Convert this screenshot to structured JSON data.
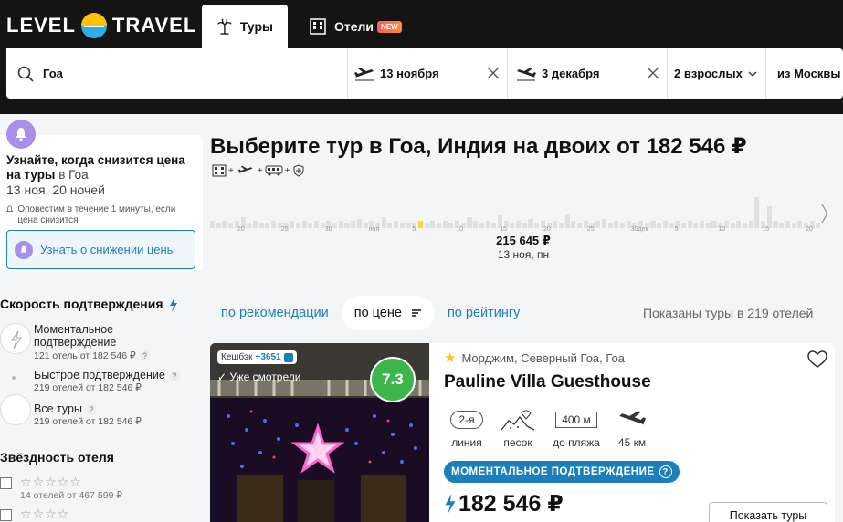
{
  "header": {
    "logo_left": "LEVEL",
    "logo_right": "TRAVEL",
    "tabs": [
      {
        "label": "Туры",
        "active": true
      },
      {
        "label": "Отели",
        "badge": "NEW",
        "active": false
      }
    ]
  },
  "search": {
    "destination": "Гоа",
    "date_from": "13 ноября",
    "date_to": "3 декабря",
    "passengers": "2 взрослых",
    "origin": "из Москвы"
  },
  "alert": {
    "title": "Узнайте, когда снизится цена на туры",
    "city": "в Гоа",
    "subtitle": "13 ноя,  20 ночей",
    "note": "Оповестим в течение 1 минуты, если цена снизится",
    "button": "Узнать о снижении цены"
  },
  "filters": {
    "confirm_title": "Скорость подтверждения",
    "confirm_options": [
      {
        "label": "Моментальное подтверждение",
        "count": "121 отель от 182 546 ₽"
      },
      {
        "label": "Быстрое подтверждение",
        "count": "219 отелей от 182 546 ₽"
      },
      {
        "label": "Все туры",
        "count": "219 отелей от 182 546 ₽"
      }
    ],
    "stars_title": "Звёздность отеля",
    "star_options": [
      {
        "stars": "☆☆☆☆☆",
        "count": "14 отелей от 467 599 ₽"
      },
      {
        "stars": "☆☆☆☆",
        "count": ""
      }
    ]
  },
  "main": {
    "title": "Выберите тур в Гоа, Индия на двоих от 182 546 ₽",
    "calendar": {
      "selected_price": "215 645 ₽",
      "selected_date": "13 ноя, пн",
      "ticks": [
        "20",
        "25",
        "30",
        "ноя",
        "5",
        "10",
        "15",
        "20",
        "25",
        "30дек",
        "5",
        "10",
        "15",
        "20"
      ],
      "bar_levels": [
        0.2,
        0.15,
        0.2,
        0.15,
        0.2,
        0.3,
        0.15,
        0.2,
        0.15,
        0.15,
        0.2,
        0.15,
        0.15,
        0.2,
        0.15,
        0.2,
        0.15,
        0.2,
        0.15,
        0.2,
        0.15,
        0.2,
        0.15,
        0.2,
        0.25,
        0.15,
        0.2,
        0.15,
        0.3,
        0.15,
        0.2,
        0.15,
        0.15,
        0.15,
        0.2,
        0.15,
        0.2,
        0.15,
        0.2,
        0.15,
        0.2,
        0.15,
        0.3,
        0.2,
        0.15,
        0.2,
        0.15,
        0.35,
        0.2,
        0.15,
        0.2,
        0.15,
        0.25,
        0.15,
        0.2,
        0.15,
        0.2,
        0.15,
        0.4,
        0.2,
        0.15,
        0.2,
        0.15,
        0.2,
        0.25,
        0.15,
        0.2,
        0.15,
        0.2,
        0.15,
        0.2,
        0.15,
        0.2,
        0.15,
        0.2,
        0.15,
        0.2,
        0.15,
        0.2,
        0.15,
        0.2,
        0.15,
        0.2,
        0.15,
        0.2,
        0.15,
        0.2,
        0.15,
        0.2,
        0.85,
        0.2,
        0.6,
        0.2,
        0.15,
        0.2,
        0.15,
        0.2,
        0.15,
        0.2,
        0.15
      ],
      "selected_index": 34
    },
    "sort": {
      "recommend": "по рекомендации",
      "price": "по цене",
      "rating": "по рейтингу"
    },
    "shown": "Показаны туры в 219 отелей"
  },
  "hotel": {
    "cashback_label": "Кешбэк",
    "cashback_value": "+3651",
    "seen": "Уже смотрели",
    "rating": "7.3",
    "location": "Морджим, Северный Гоа, Гоа",
    "name": "Pauline Villa Guesthouse",
    "features": [
      {
        "value": "2-я",
        "label": "линия"
      },
      {
        "value": "",
        "label": "песок"
      },
      {
        "value": "400 м",
        "label": "до пляжа"
      },
      {
        "value": "",
        "label": "45 км"
      }
    ],
    "instant": "МОМЕНТАЛЬНОЕ ПОДТВЕРЖДЕНИЕ",
    "price": "182 546 ₽",
    "button": "Показать туры"
  },
  "colors": {
    "accent": "#1b7fbc",
    "rating_green": "#3cb54a",
    "header_bg": "#141414",
    "bell": "#a88ee8"
  }
}
